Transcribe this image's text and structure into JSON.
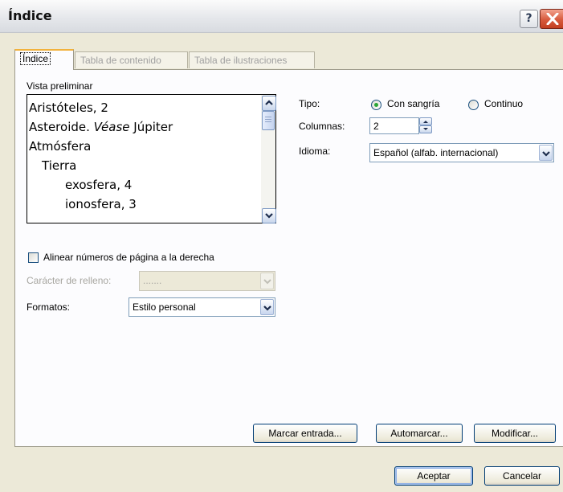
{
  "window": {
    "title": "Índice"
  },
  "tabs": [
    {
      "label": "Índice"
    },
    {
      "label": "Tabla de contenido"
    },
    {
      "label": "Tabla de ilustraciones"
    }
  ],
  "preview": {
    "label": "Vista preliminar",
    "entries": [
      {
        "text": "Aristóteles, 2"
      },
      {
        "text_before": "Asteroide. ",
        "text_italic": "Véase",
        "text_after": " Júpiter"
      },
      {
        "text": "Atmósfera"
      },
      {
        "text": "Tierra"
      },
      {
        "text": "exosfera, 4"
      },
      {
        "text": "ionosfera, 3"
      }
    ]
  },
  "tipo": {
    "label": "Tipo:",
    "option1": "Con sangría",
    "option2": "Continuo",
    "selected": "Con sangría"
  },
  "columnas": {
    "label": "Columnas:",
    "value": "2"
  },
  "idioma": {
    "label": "Idioma:",
    "value": "Español (alfab. internacional)"
  },
  "align_checkbox": {
    "label": "Alinear números de página a la derecha",
    "checked": false
  },
  "relleno": {
    "label": "Carácter de relleno:",
    "value": "......."
  },
  "formatos": {
    "label": "Formatos:",
    "value": "Estilo personal"
  },
  "buttons": {
    "marcar": "Marcar entrada...",
    "automarcar": "Automarcar...",
    "modificar": "Modificar...",
    "aceptar": "Aceptar",
    "cancelar": "Cancelar"
  },
  "colors": {
    "title_bg": "#e4e6ea",
    "dialog_bg": "#ece9d8",
    "close_button": "#d85a3c",
    "radio_dot": "#2aa635",
    "tab_highlight": "#f2b23c"
  }
}
